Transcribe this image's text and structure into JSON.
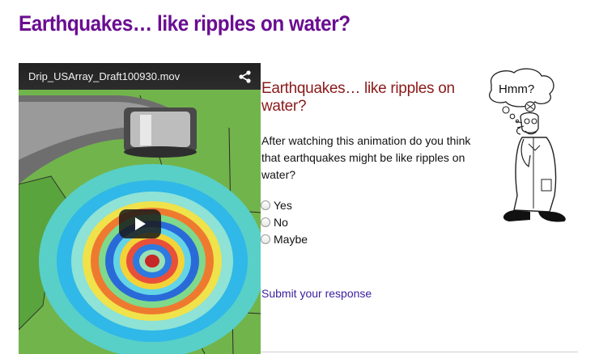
{
  "page": {
    "title": "Earthquakes…  like ripples on water?"
  },
  "video": {
    "title": "Drip_USArray_Draft100930.mov",
    "share_icon": "share-icon",
    "play_icon": "play-icon"
  },
  "question": {
    "title": "Earthquakes…  like ripples on water?",
    "text": "After watching this animation do you think that earthquakes might be like ripples on water?",
    "options": [
      "Yes",
      "No",
      "Maybe"
    ],
    "submit_label": "Submit your response"
  },
  "cartoon": {
    "bubble_text": "Hmm?"
  },
  "colors": {
    "title": "#6a0d91",
    "question_title": "#8b1a1a",
    "link": "#3a1fa0"
  }
}
